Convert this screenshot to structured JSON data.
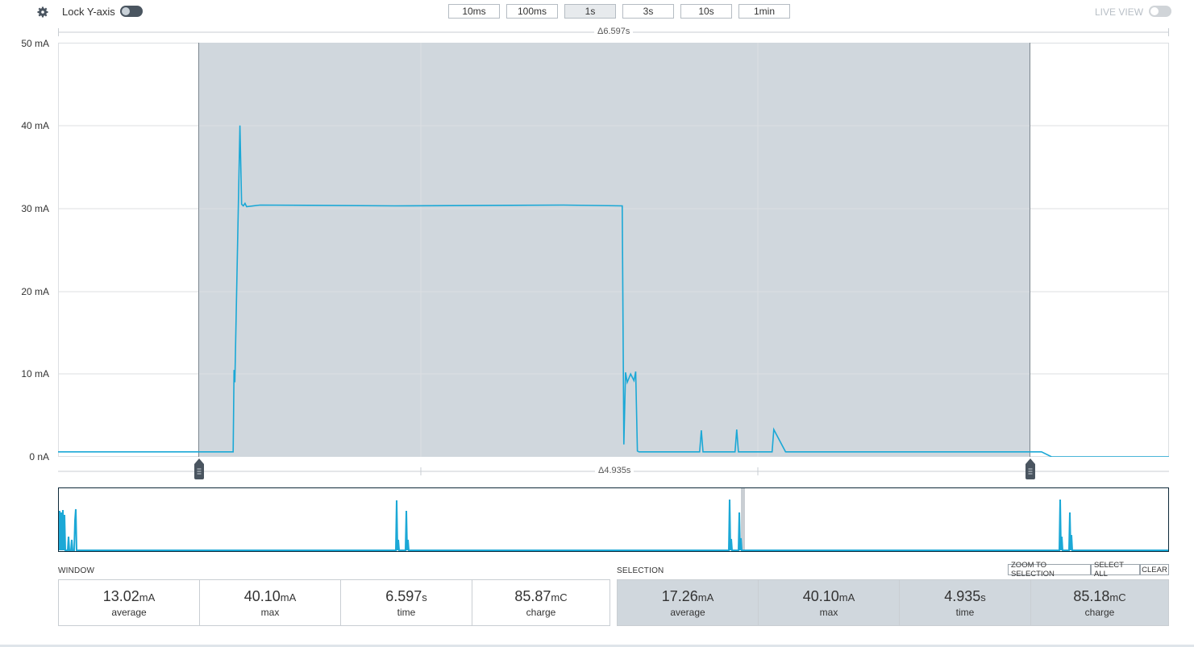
{
  "toolbar": {
    "lock_label": "Lock Y-axis",
    "lock_on": true,
    "windows": [
      "10ms",
      "100ms",
      "1s",
      "3s",
      "10s",
      "1min"
    ],
    "active_window": "1s",
    "live_label": "LIVE VIEW",
    "live_on": false
  },
  "chart": {
    "top_delta": "Δ6.597s",
    "bottom_delta": "Δ4.935s",
    "y_ticks": [
      "0 nA",
      "10 mA",
      "20 mA",
      "30 mA",
      "40 mA",
      "50 mA"
    ]
  },
  "chart_data": {
    "type": "line",
    "ylim": [
      0,
      50
    ],
    "ylabel": "",
    "xlabel": "",
    "window_s": 6.597,
    "selection_s": [
      1.045,
      5.98
    ],
    "series": [
      {
        "color": "#1ba8d6",
        "x": [
          0.0,
          1.04,
          1.045,
          1.05,
          1.08,
          1.09,
          1.1,
          1.11,
          1.12,
          1.2,
          2.0,
          3.0,
          3.35,
          3.36,
          3.37,
          3.38,
          3.4,
          3.42,
          3.43,
          3.44,
          3.45,
          3.5,
          3.81,
          3.82,
          3.83,
          3.84,
          4.02,
          4.03,
          4.04,
          4.24,
          4.25,
          4.32,
          4.33,
          4.34,
          4.36,
          4.37,
          4.38,
          4.39,
          4.4,
          4.42,
          4.43,
          4.44,
          4.45,
          4.46,
          4.47,
          4.48,
          4.5,
          4.52,
          4.54,
          4.55,
          4.56,
          4.58,
          4.59,
          4.6,
          4.61,
          4.62,
          4.63,
          4.64,
          4.65,
          4.66,
          4.67,
          4.7,
          4.8,
          5.0,
          5.2,
          5.21,
          5.22,
          5.23,
          5.24,
          5.25,
          5.26,
          5.27,
          5.28,
          5.3,
          5.4,
          5.42,
          5.43,
          5.44,
          5.45,
          5.46,
          5.47,
          5.48,
          5.49,
          5.5,
          5.51,
          5.52,
          5.53,
          5.55,
          5.6,
          5.65,
          5.7,
          5.75,
          5.78,
          5.79,
          5.8,
          5.81,
          5.82,
          5.83,
          5.84,
          5.9,
          6.0,
          6.597
        ],
        "y": [
          0.6,
          0.6,
          10.5,
          9.0,
          40.0,
          30.5,
          30.3,
          30.6,
          30.2,
          30.4,
          30.3,
          30.4,
          30.3,
          1.5,
          10.2,
          9.0,
          10.0,
          9.2,
          10.3,
          0.7,
          0.6,
          0.6,
          0.6,
          3.2,
          0.6,
          0.6,
          0.6,
          3.3,
          0.6,
          0.6,
          3.3,
          0.6,
          0.6,
          0.6,
          0.6,
          0.6,
          0.6,
          0.6,
          0.6,
          0.6,
          0.6,
          0.6,
          0.6,
          0.6,
          0.6,
          0.6,
          0.6,
          0.6,
          0.6,
          0.6,
          0.6,
          0.6,
          0.6,
          0.6,
          0.6,
          0.6,
          0.6,
          0.6,
          0.6,
          0.6,
          0.6,
          0.6,
          0.6,
          0.6,
          0.6,
          0.6,
          0.6,
          0.6,
          0.6,
          0.6,
          0.6,
          0.6,
          0.6,
          0.6,
          0.6,
          0.6,
          0.6,
          0.6,
          0.6,
          0.6,
          0.6,
          0.6,
          0.6,
          0.6,
          0.6,
          0.6,
          0.6,
          0.6,
          0.6,
          0.6,
          0.6,
          0.6,
          0.6,
          0.6,
          0.6,
          0.6,
          0.6,
          0.6,
          0.6,
          0.0,
          0.0,
          0.0
        ]
      }
    ]
  },
  "window": {
    "title": "WINDOW",
    "average": {
      "value": "13.02",
      "unit": "mA",
      "label": "average"
    },
    "max": {
      "value": "40.10",
      "unit": "mA",
      "label": "max"
    },
    "time": {
      "value": "6.597",
      "unit": "s",
      "label": "time"
    },
    "charge": {
      "value": "85.87",
      "unit": "mC",
      "label": "charge"
    }
  },
  "selection": {
    "title": "SELECTION",
    "zoom_label": "ZOOM TO SELECTION",
    "select_all_label": "SELECT ALL",
    "clear_label": "CLEAR",
    "average": {
      "value": "17.26",
      "unit": "mA",
      "label": "average"
    },
    "max": {
      "value": "40.10",
      "unit": "mA",
      "label": "max"
    },
    "time": {
      "value": "4.935",
      "unit": "s",
      "label": "time"
    },
    "charge": {
      "value": "85.18",
      "unit": "mC",
      "label": "charge"
    }
  }
}
